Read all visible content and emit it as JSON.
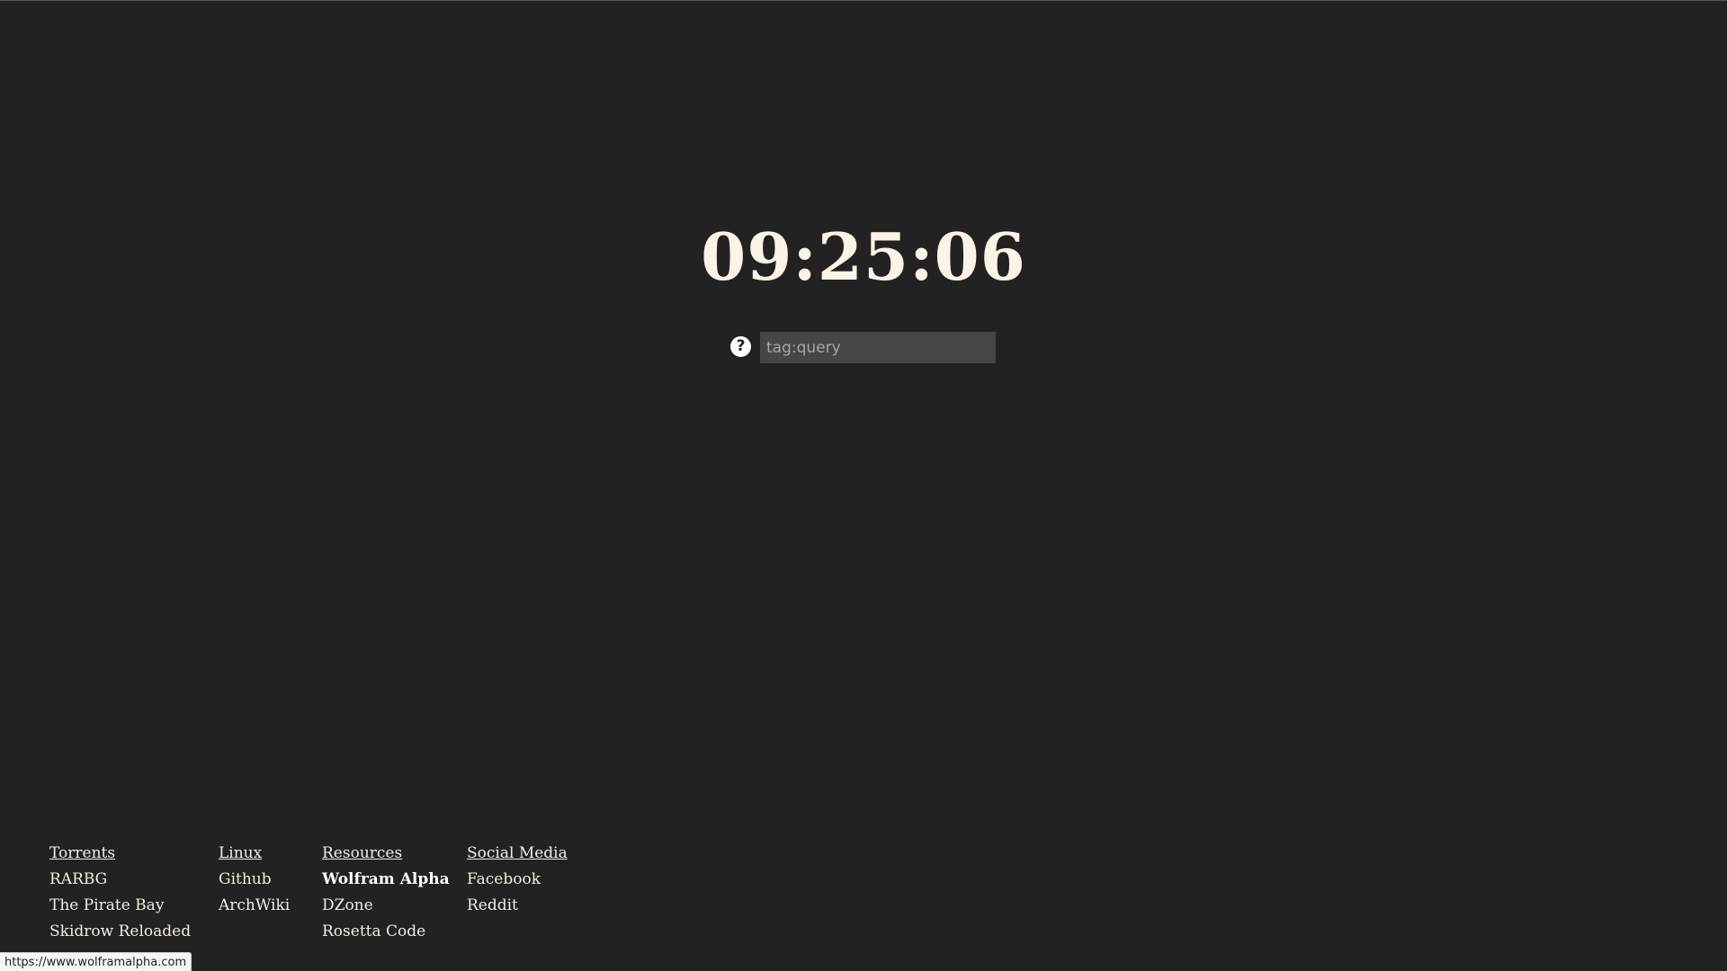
{
  "clock": {
    "time": "09:25:06"
  },
  "search": {
    "help_icon": "question-circle-icon",
    "help_glyph": "?",
    "placeholder": "tag:query",
    "value": ""
  },
  "links": {
    "torrents": {
      "heading": "Torrents",
      "items": [
        "RARBG",
        "The Pirate Bay",
        "Skidrow Reloaded"
      ]
    },
    "linux": {
      "heading": "Linux",
      "items": [
        "Github",
        "ArchWiki"
      ]
    },
    "resources": {
      "heading": "Resources",
      "items": [
        "Wolfram Alpha",
        "DZone",
        "Rosetta Code"
      ]
    },
    "social": {
      "heading": "Social Media",
      "items": [
        "Facebook",
        "Reddit"
      ]
    }
  },
  "status_bar": {
    "url": "https://www.wolframalpha.com"
  },
  "colors": {
    "background": "#222222",
    "text": "#f4ede2",
    "input_background": "#464646"
  }
}
